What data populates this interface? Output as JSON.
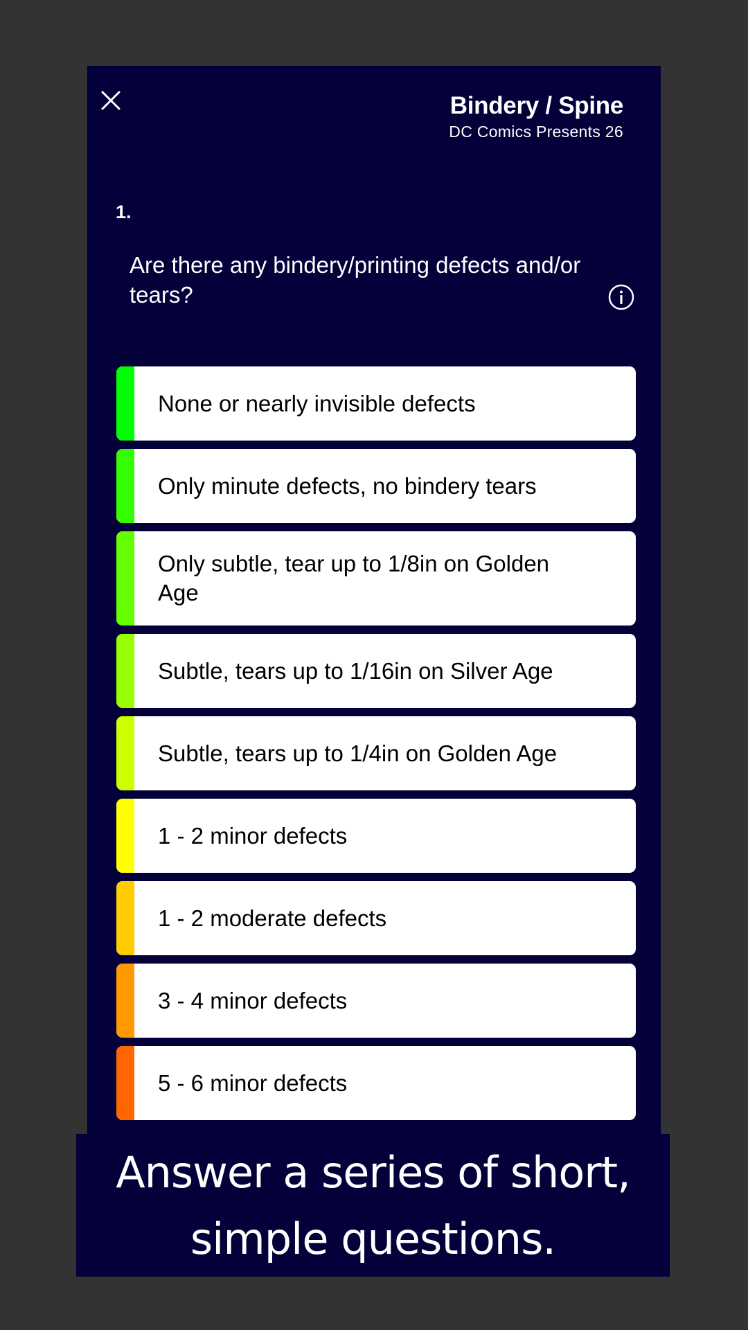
{
  "header": {
    "close_icon": "close-icon",
    "title": "Bindery / Spine",
    "subtitle": "DC Comics Presents 26"
  },
  "question": {
    "number": "1.",
    "text": "Are there any bindery/printing defects and/or tears?",
    "info_icon": "info-icon"
  },
  "options": [
    {
      "label": "None or nearly invisible defects",
      "color": "#00ff00"
    },
    {
      "label": "Only minute defects, no bindery tears",
      "color": "#33ff00"
    },
    {
      "label": "Only subtle, tear up to 1/8in on Golden Age",
      "color": "#66ff00"
    },
    {
      "label": "Subtle, tears up to 1/16in on Silver Age",
      "color": "#99ff00"
    },
    {
      "label": "Subtle, tears up to 1/4in on Golden Age",
      "color": "#ccff00"
    },
    {
      "label": "1 - 2 minor defects",
      "color": "#ffff00"
    },
    {
      "label": "1 - 2 moderate defects",
      "color": "#ffcc00"
    },
    {
      "label": "3 - 4 minor defects",
      "color": "#ff9900"
    },
    {
      "label": "5 - 6 minor defects",
      "color": "#ff6600"
    }
  ],
  "caption": {
    "line1": "Answer a series of short,",
    "line2": "simple questions."
  },
  "colors": {
    "page_background": "#333333",
    "panel_background": "#03003a",
    "card_background": "#ffffff"
  }
}
